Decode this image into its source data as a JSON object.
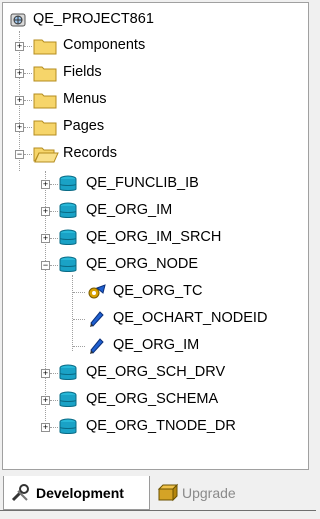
{
  "tree": {
    "root": "QE_PROJECT861",
    "folders": [
      "Components",
      "Fields",
      "Menus",
      "Pages",
      "Records"
    ],
    "records": [
      "QE_FUNCLIB_IB",
      "QE_ORG_IM",
      "QE_ORG_IM_SRCH",
      "QE_ORG_NODE",
      "QE_ORG_SCH_DRV",
      "QE_ORG_SCHEMA",
      "QE_ORG_TNODE_DR"
    ],
    "node_children": [
      "QE_ORG_TC",
      "QE_OCHART_NODEID",
      "QE_ORG_IM"
    ]
  },
  "tabs": {
    "development": "Development",
    "upgrade": "Upgrade"
  }
}
